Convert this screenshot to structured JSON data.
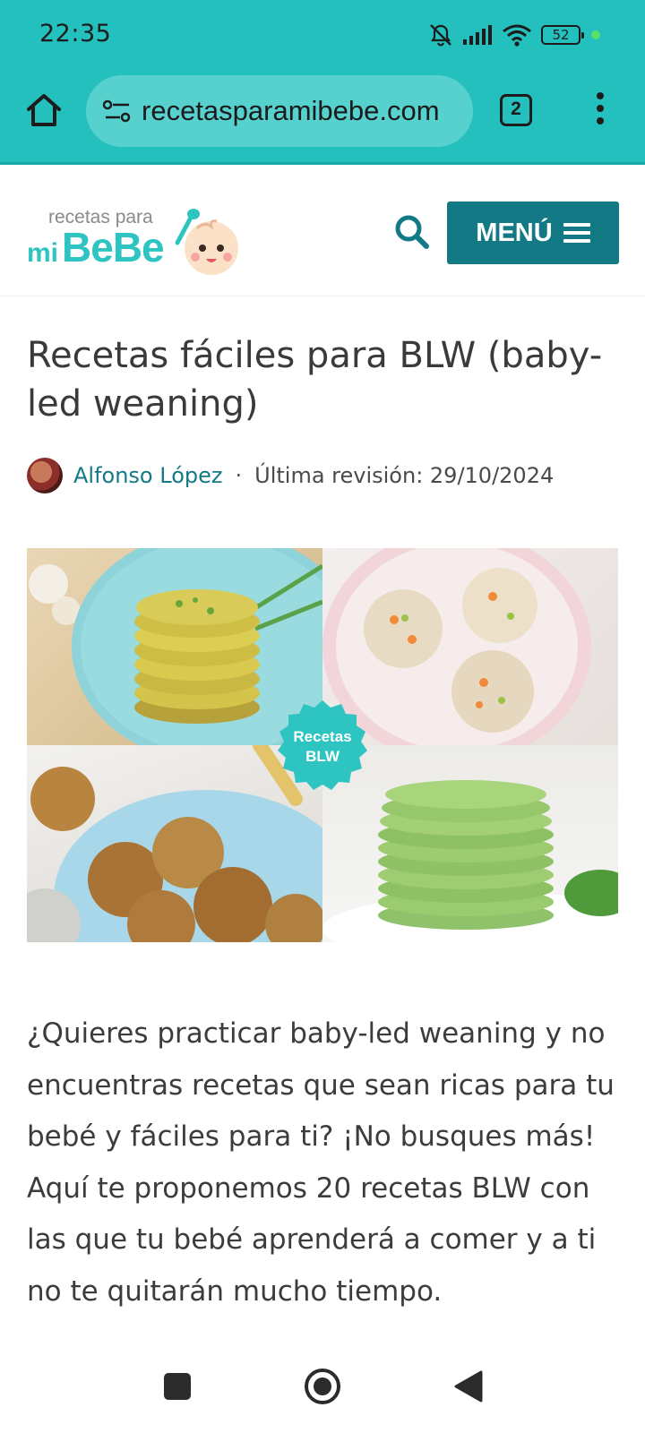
{
  "status_bar": {
    "time": "22:35",
    "battery": "52",
    "icons": [
      "bell-muted-icon",
      "signal-icon",
      "wifi-icon",
      "battery-icon"
    ]
  },
  "browser": {
    "url": "recetasparamibebe.com",
    "tab_count": "2",
    "icons": [
      "home-icon",
      "site-settings-icon",
      "tabs-icon",
      "more-icon"
    ]
  },
  "site": {
    "logo_small": "recetas para",
    "logo_mi": "mi",
    "logo_big": "BeBe",
    "menu_label": "MENÚ",
    "brand_color": "#23c0bd",
    "accent_color": "#137a85"
  },
  "article": {
    "title": "Recetas fáciles para BLW (baby-led weaning)",
    "author": "Alfonso López",
    "separator": "·",
    "revision": "Última revisión: 29/10/2024",
    "hero_badge_line1": "Recetas",
    "hero_badge_line2": "BLW",
    "intro": "¿Quieres practicar baby-led weaning y no encuentras recetas que sean ricas para tu bebé y fáciles para ti? ¡No busques más! Aquí te proponemos 20 recetas BLW con las que tu bebé aprenderá a comer y a ti no te quitarán mucho tiempo."
  },
  "nav": {
    "icons": [
      "recents-icon",
      "home-circle-icon",
      "back-icon"
    ]
  }
}
